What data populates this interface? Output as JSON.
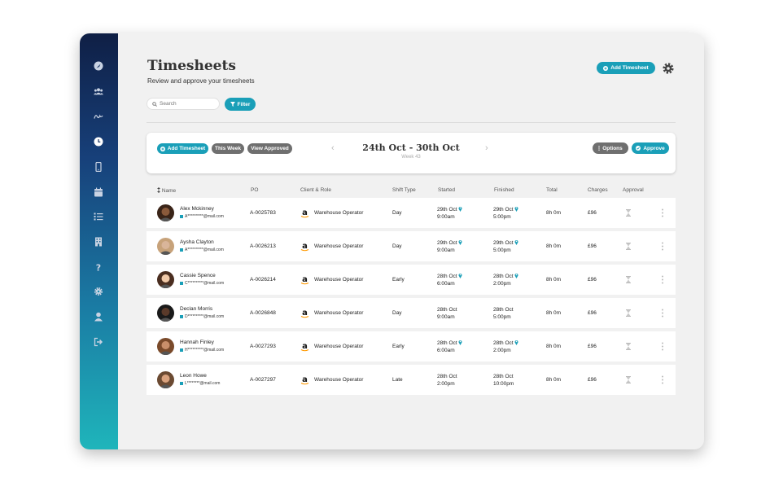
{
  "page": {
    "title": "Timesheets",
    "subtitle": "Review and approve your timesheets"
  },
  "sidebar": {
    "items": [
      {
        "icon": "dashboard-icon"
      },
      {
        "icon": "users-icon"
      },
      {
        "icon": "signature-icon"
      },
      {
        "icon": "clock-icon"
      },
      {
        "icon": "mobile-icon"
      },
      {
        "icon": "calendar-icon"
      },
      {
        "icon": "list-icon"
      },
      {
        "icon": "building-icon"
      },
      {
        "icon": "help-icon"
      },
      {
        "icon": "settings-icon"
      },
      {
        "icon": "user-icon"
      },
      {
        "icon": "logout-icon"
      }
    ]
  },
  "header": {
    "add_timesheet_label": "Add Timesheet"
  },
  "search": {
    "placeholder": "Search"
  },
  "filter": {
    "label": "Filter"
  },
  "toolbar": {
    "add_timesheet_label": "Add Timesheet",
    "this_week_label": "This Week",
    "view_approved_label": "View Approved",
    "week_range": "24th Oct - 30th Oct",
    "week_number": "Week 43",
    "options_label": "Options",
    "approve_label": "Approve"
  },
  "table": {
    "columns": [
      "Name",
      "PO",
      "Client & Role",
      "Shift Type",
      "Started",
      "Finished",
      "Total",
      "Charges",
      "Approval"
    ],
    "rows": [
      {
        "name": "Alex Mckinney",
        "email": "A**********@mail.com",
        "po": "A-0025783",
        "role": "Warehouse Operator",
        "shift": "Day",
        "started_date": "29th Oct",
        "started_time": "9:00am",
        "started_pin": true,
        "finished_date": "29th Oct",
        "finished_time": "5:00pm",
        "finished_pin": true,
        "total": "8h 0m",
        "charges": "£96"
      },
      {
        "name": "Aysha Clayton",
        "email": "A**********@mail.com",
        "po": "A-0026213",
        "role": "Warehouse Operator",
        "shift": "Day",
        "started_date": "29th Oct",
        "started_time": "9:00am",
        "started_pin": true,
        "finished_date": "29th Oct",
        "finished_time": "5:00pm",
        "finished_pin": true,
        "total": "8h 0m",
        "charges": "£96"
      },
      {
        "name": "Cassie Spence",
        "email": "C**********@mail.com",
        "po": "A-0026214",
        "role": "Warehouse Operator",
        "shift": "Early",
        "started_date": "28th Oct",
        "started_time": "6:00am",
        "started_pin": true,
        "finished_date": "28th Oct",
        "finished_time": "2:00pm",
        "finished_pin": true,
        "total": "8h 0m",
        "charges": "£96"
      },
      {
        "name": "Declan Morris",
        "email": "D**********@mail.com",
        "po": "A-0026848",
        "role": "Warehouse Operator",
        "shift": "Day",
        "started_date": "28th Oct",
        "started_time": "9:00am",
        "started_pin": false,
        "finished_date": "28th Oct",
        "finished_time": "5:00pm",
        "finished_pin": false,
        "total": "8h 0m",
        "charges": "£96"
      },
      {
        "name": "Hannah Finley",
        "email": "H**********@mail.com",
        "po": "A-0027293",
        "role": "Warehouse Operator",
        "shift": "Early",
        "started_date": "28th Oct",
        "started_time": "6:00am",
        "started_pin": true,
        "finished_date": "28th Oct",
        "finished_time": "2:00pm",
        "finished_pin": true,
        "total": "8h 0m",
        "charges": "£96"
      },
      {
        "name": "Leon Howe",
        "email": "L********@mail.com",
        "po": "A-0027297",
        "role": "Warehouse Operator",
        "shift": "Late",
        "started_date": "28th Oct",
        "started_time": "2:00pm",
        "started_pin": false,
        "finished_date": "28th Oct",
        "finished_time": "10:00pm",
        "finished_pin": false,
        "total": "8h 0m",
        "charges": "£96"
      }
    ]
  },
  "colors": {
    "accent": "#1a9fb8",
    "secondary": "#6f6f6f",
    "sidebar_top": "#0f1f45",
    "sidebar_bottom": "#1fb5bb"
  }
}
